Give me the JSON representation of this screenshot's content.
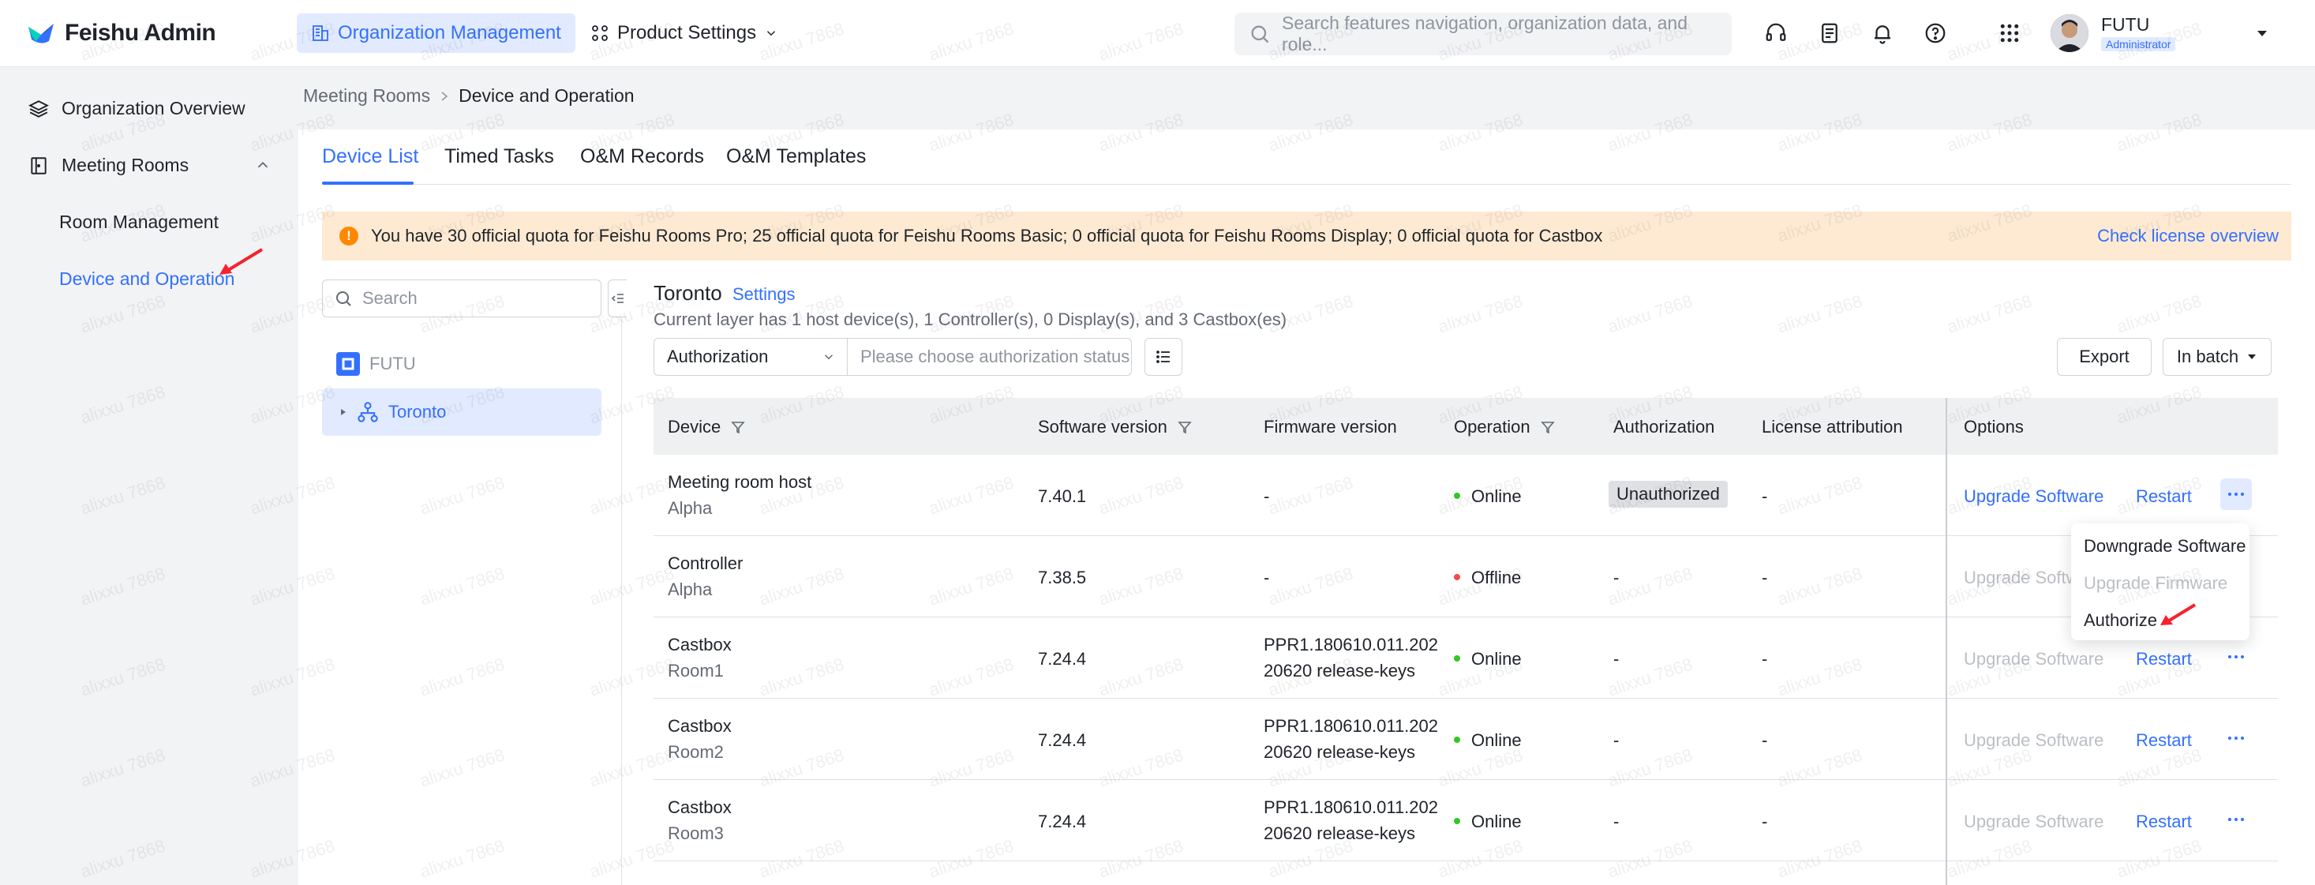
{
  "app": {
    "title": "Feishu Admin",
    "accent_color": "#3370ff"
  },
  "topnav": {
    "tabs": [
      {
        "label": "Organization Management",
        "icon": "building-icon",
        "active": true
      },
      {
        "label": "Product Settings",
        "icon": "product-settings-icon",
        "active": false
      }
    ],
    "search_placeholder": "Search features navigation, organization data, and role...",
    "icons": [
      "headset-icon",
      "feedback-icon",
      "bell-icon",
      "help-icon",
      "apps-grid-icon"
    ],
    "user": {
      "name": "FUTU",
      "role": "Administrator"
    }
  },
  "sidebar": {
    "items": [
      {
        "label": "Organization Overview",
        "icon": "layers-icon"
      },
      {
        "label": "Meeting Rooms",
        "icon": "meeting-room-icon",
        "expanded": true,
        "children": [
          {
            "label": "Room Management",
            "active": false
          },
          {
            "label": "Device and Operation",
            "active": true
          }
        ]
      }
    ]
  },
  "breadcrumb": {
    "parent": "Meeting Rooms",
    "current": "Device and Operation"
  },
  "tabs": [
    {
      "label": "Device List",
      "active": true
    },
    {
      "label": "Timed Tasks",
      "active": false
    },
    {
      "label": "O&M Records",
      "active": false
    },
    {
      "label": "O&M Templates",
      "active": false
    }
  ],
  "notice": {
    "text": "You have 30 official quota for Feishu Rooms Pro; 25 official quota for Feishu Rooms Basic; 0 official quota for Feishu Rooms Display; 0 official quota for Castbox",
    "link": "Check license overview",
    "color": "#feead2"
  },
  "tree": {
    "search_placeholder": "Search",
    "root": "FUTU",
    "node": "Toronto"
  },
  "location": {
    "name": "Toronto",
    "settings_label": "Settings",
    "summary": "Current layer has 1 host device(s), 1 Controller(s), 0 Display(s), and 3 Castbox(es)"
  },
  "filters": {
    "select_value": "Authorization",
    "input_placeholder": "Please choose authorization status",
    "export_label": "Export",
    "batch_label": "In batch"
  },
  "table": {
    "headers": [
      "Device",
      "Software version",
      "Firmware version",
      "Operation",
      "Authorization",
      "License attribution",
      "Options"
    ],
    "rows": [
      {
        "device": "Meeting room host",
        "room": "Alpha",
        "software": "7.40.1",
        "firmware_1": "-",
        "firmware_2": "",
        "status": "Online",
        "status_color": "#34c724",
        "authorization": "Unauthorized",
        "license": "-",
        "upgrade": "Upgrade Software",
        "upgrade_enabled": true,
        "restart": "Restart"
      },
      {
        "device": "Controller",
        "room": "Alpha",
        "software": "7.38.5",
        "firmware_1": "-",
        "firmware_2": "",
        "status": "Offline",
        "status_color": "#f54a45",
        "authorization": "-",
        "license": "-",
        "upgrade": "Upgrade Software",
        "upgrade_enabled": false,
        "restart": ""
      },
      {
        "device": "Castbox",
        "room": "Room1",
        "software": "7.24.4",
        "firmware_1": "PPR1.180610.011.202",
        "firmware_2": "20620 release-keys",
        "status": "Online",
        "status_color": "#34c724",
        "authorization": "-",
        "license": "-",
        "upgrade": "Upgrade Software",
        "upgrade_enabled": false,
        "restart": "Restart"
      },
      {
        "device": "Castbox",
        "room": "Room2",
        "software": "7.24.4",
        "firmware_1": "PPR1.180610.011.202",
        "firmware_2": "20620 release-keys",
        "status": "Online",
        "status_color": "#34c724",
        "authorization": "-",
        "license": "-",
        "upgrade": "Upgrade Software",
        "upgrade_enabled": false,
        "restart": "Restart"
      },
      {
        "device": "Castbox",
        "room": "Room3",
        "software": "7.24.4",
        "firmware_1": "PPR1.180610.011.202",
        "firmware_2": "20620 release-keys",
        "status": "Online",
        "status_color": "#34c724",
        "authorization": "-",
        "license": "-",
        "upgrade": "Upgrade Software",
        "upgrade_enabled": false,
        "restart": "Restart"
      }
    ]
  },
  "dropdown": {
    "items": [
      {
        "label": "Downgrade Software",
        "enabled": true
      },
      {
        "label": "Upgrade Firmware",
        "enabled": false
      },
      {
        "label": "Authorize",
        "enabled": true
      }
    ]
  },
  "watermark_text": "alixxu 7868"
}
